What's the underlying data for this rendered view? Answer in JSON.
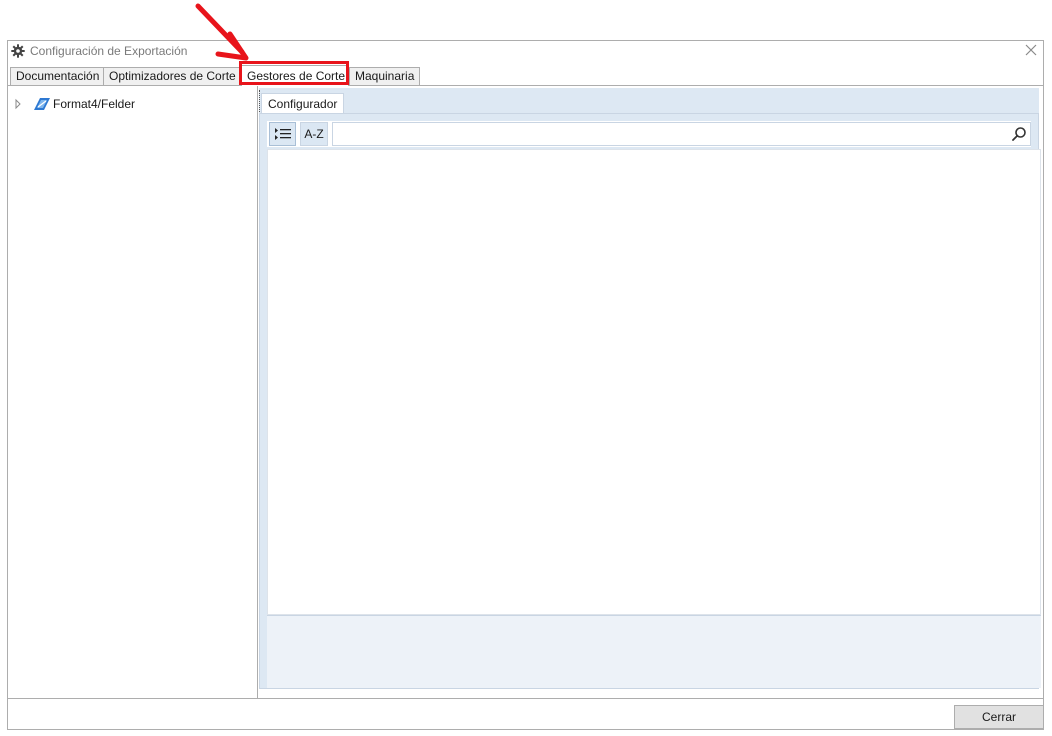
{
  "window": {
    "title": "Configuración de Exportación"
  },
  "tabs": [
    {
      "label": "Documentación",
      "active": false
    },
    {
      "label": "Optimizadores de Corte",
      "active": false
    },
    {
      "label": "Gestores de Corte",
      "active": true
    },
    {
      "label": "Maquinaria",
      "active": false
    }
  ],
  "tree": {
    "items": [
      {
        "label": "Format4/Felder",
        "expanded": false
      }
    ]
  },
  "property_panel": {
    "tab_label": "Configurador",
    "categorized_icon": "categorized-list-icon",
    "alphabetical_label": "A-Z",
    "search_value": "",
    "search_placeholder": ""
  },
  "footer": {
    "close_label": "Cerrar"
  },
  "annotations": {
    "highlight_color": "#e8141b",
    "arrow_color": "#e8141b"
  }
}
